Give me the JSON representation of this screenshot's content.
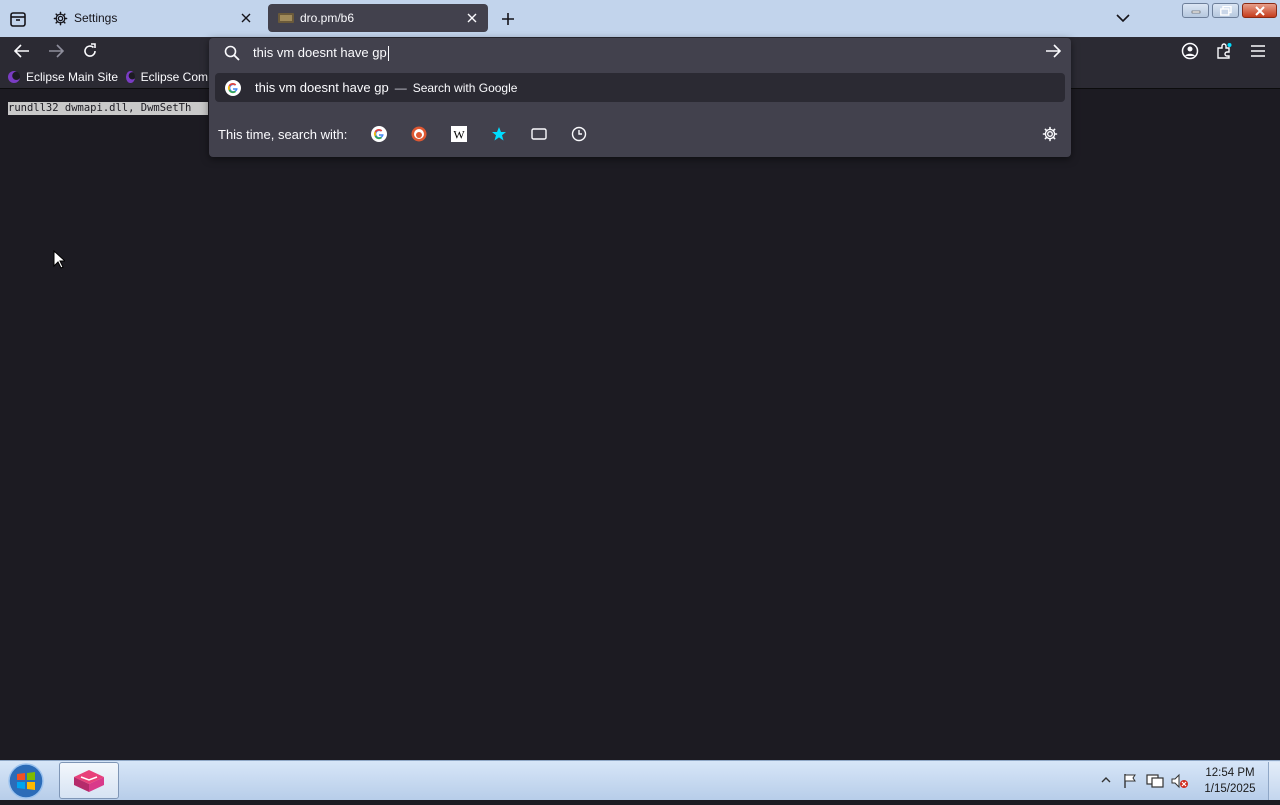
{
  "tabs": [
    {
      "label": "Settings",
      "icon": "gear-icon"
    },
    {
      "label": "dro.pm/b6",
      "icon": "site-favicon-icon"
    }
  ],
  "bookmarks": [
    {
      "label": "Eclipse Main Site"
    },
    {
      "label": "Eclipse Com"
    }
  ],
  "page": {
    "text": "rundll32 dwmapi.dll, DwmSetTh"
  },
  "urlbar": {
    "value": "this vm doesnt have gp",
    "suggestion": {
      "query": "this vm doesnt have gp",
      "separator": "—",
      "action": "Search with Google"
    },
    "engines_label": "This time, search with:",
    "engines": [
      "Google",
      "DuckDuckGo",
      "Wikipedia",
      "Bookmarks",
      "Tabs",
      "History"
    ]
  },
  "taskbar": {
    "time": "12:54 PM",
    "date": "1/15/2025"
  },
  "colors": {
    "toolbar_bg": "#2b2a33",
    "panel_bg": "#42414d",
    "accent": "#00ddff",
    "tabbar_bg": "#c2d4ec"
  }
}
